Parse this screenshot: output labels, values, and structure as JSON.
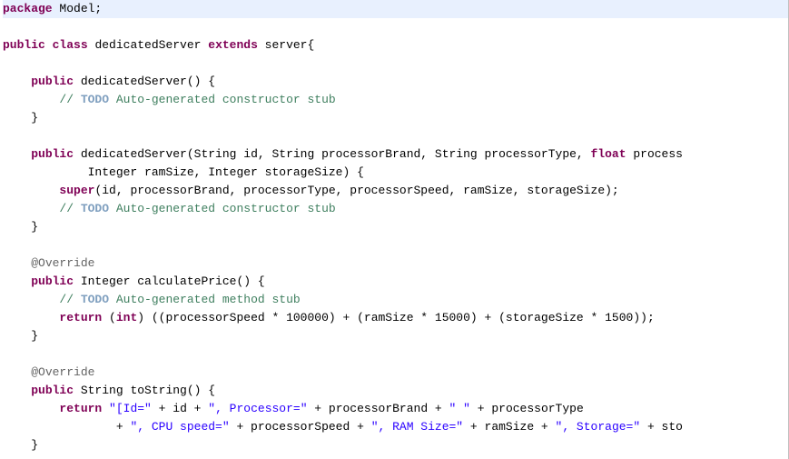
{
  "lines": {
    "l1_keyword": "package",
    "l1_text": " Model;",
    "l3_kw1": "public",
    "l3_kw2": "class",
    "l3_text1": " dedicatedServer ",
    "l3_kw3": "extends",
    "l3_text2": " server{",
    "l5_kw": "public",
    "l5_text": " dedicatedServer() {",
    "l6_comment_slash": "// ",
    "l6_todo": "TODO",
    "l6_comment_rest": " Auto-generated constructor stub",
    "l7_text": "}",
    "l9_kw": "public",
    "l9_text": " dedicatedServer(String id, String processorBrand, String processorType, ",
    "l9_kw2": "float",
    "l9_text2": " process",
    "l10_text": "Integer ramSize, Integer storageSize) {",
    "l11_kw": "super",
    "l11_text": "(id, processorBrand, processorType, processorSpeed, ramSize, storageSize);",
    "l12_comment_slash": "// ",
    "l12_todo": "TODO",
    "l12_comment_rest": " Auto-generated constructor stub",
    "l13_text": "}",
    "l15_annotation": "@Override",
    "l16_kw": "public",
    "l16_text": " Integer calculatePrice() {",
    "l17_comment_slash": "// ",
    "l17_todo": "TODO",
    "l17_comment_rest": " Auto-generated method stub",
    "l18_kw1": "return",
    "l18_text1": " (",
    "l18_kw2": "int",
    "l18_text2": ") ((processorSpeed * 100000) + (ramSize * 15000) + (storageSize * 1500));",
    "l19_text": "}",
    "l21_annotation": "@Override",
    "l22_kw": "public",
    "l22_text": " String toString() {",
    "l23_kw": "return",
    "l23_text1": " ",
    "l23_str1": "\"[Id=\"",
    "l23_text2": " + id + ",
    "l23_str2": "\", Processor=\"",
    "l23_text3": " + processorBrand + ",
    "l23_str3": "\" \"",
    "l23_text4": " + processorType",
    "l24_text1": "+ ",
    "l24_str1": "\", CPU speed=\"",
    "l24_text2": " + processorSpeed + ",
    "l24_str2": "\", RAM Size=\"",
    "l24_text3": " + ramSize + ",
    "l24_str3": "\", Storage=\"",
    "l24_text4": " + sto",
    "l25_text": "}"
  }
}
